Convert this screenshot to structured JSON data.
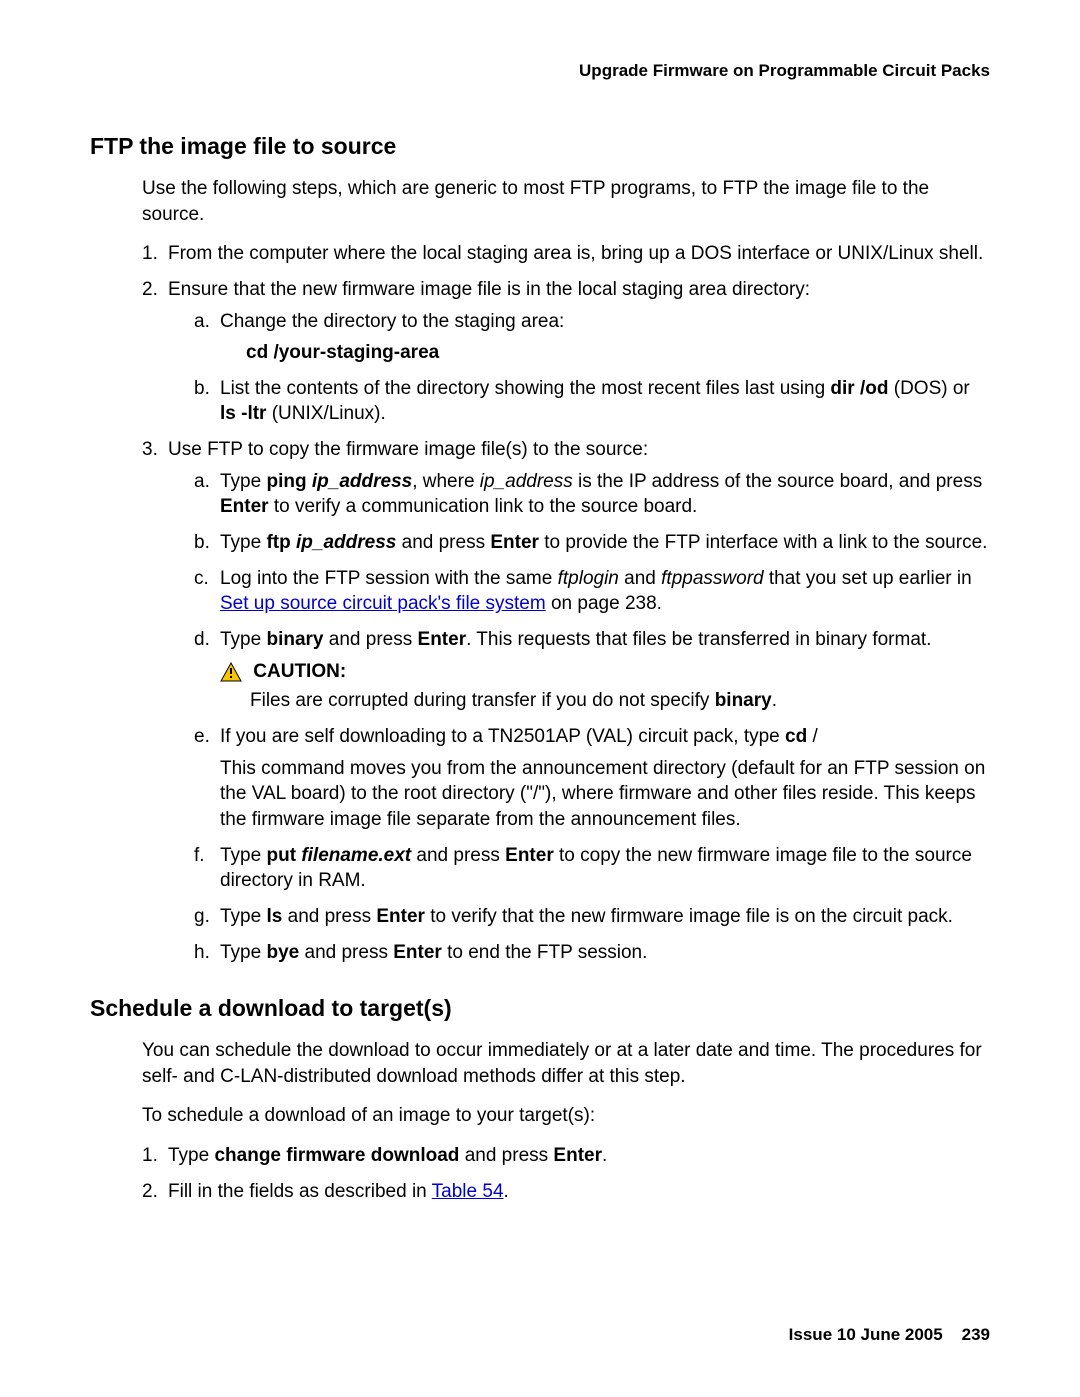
{
  "header": {
    "running_head": "Upgrade Firmware on Programmable Circuit Packs"
  },
  "section1": {
    "title": "FTP the image file to source",
    "intro": "Use the following steps, which are generic to most FTP programs, to FTP the image file to the source.",
    "step1": {
      "marker": "1.",
      "text": "From the computer where the local staging area is, bring up a DOS interface or UNIX/Linux shell."
    },
    "step2": {
      "marker": "2.",
      "text": "Ensure that the new firmware image file is in the local staging area directory:",
      "a": {
        "marker": "a.",
        "text": "Change the directory to the staging area:"
      },
      "cmd": "cd /your-staging-area",
      "b": {
        "marker": "b.",
        "pre": "List the contents of the directory showing the most recent files last using ",
        "cmd1": "dir /od",
        "mid": " (DOS) or ",
        "cmd2": "ls -ltr",
        "post": " (UNIX/Linux)."
      }
    },
    "step3": {
      "marker": "3.",
      "text": "Use FTP to copy the firmware image file(s) to the source:",
      "a": {
        "marker": "a.",
        "t1": "Type ",
        "cmd_ping": "ping ",
        "arg_ip": "ip_address",
        "t2": ", where ",
        "arg_ip2": "ip_address",
        "t3": " is the IP address of the source board, and press ",
        "enter": "Enter",
        "t4": " to verify a communication link to the source board."
      },
      "b": {
        "marker": "b.",
        "t1": "Type ",
        "cmd_ftp": "ftp ",
        "arg_ip": "ip_address",
        "t2": " and press ",
        "enter": "Enter",
        "t3": " to provide the FTP interface with a link to the source."
      },
      "c": {
        "marker": "c.",
        "t1": "Log into the FTP session with the same ",
        "arg1": "ftplogin",
        "t2": " and ",
        "arg2": "ftppassword",
        "t3": " that you set up earlier in ",
        "link": "Set up source circuit pack's file system",
        "t4": " on page 238."
      },
      "d": {
        "marker": "d.",
        "t1": "Type ",
        "cmd": "binary",
        "t2": " and press ",
        "enter": "Enter",
        "t3": ". This requests that files be transferred in binary format."
      },
      "caution": {
        "label": "CAUTION:",
        "t1": "Files are corrupted during transfer if you do not specify ",
        "b": "binary",
        "t2": "."
      },
      "e": {
        "marker": "e.",
        "t1": "If you are self downloading to a TN2501AP (VAL) circuit pack, type ",
        "cmd": "cd",
        "t2": " /",
        "para2": "This command moves you from the announcement directory (default for an FTP session on the VAL board) to the root directory (\"/\"), where firmware and other files reside. This keeps the firmware image file separate from the announcement files."
      },
      "f": {
        "marker": "f.",
        "t1": "Type ",
        "cmd": "put ",
        "arg": "filename.ext",
        "t2": " and press ",
        "enter": "Enter",
        "t3": " to copy the new firmware image file to the source directory in RAM."
      },
      "g": {
        "marker": "g.",
        "t1": "Type ",
        "cmd": "ls",
        "t2": " and press ",
        "enter": "Enter",
        "t3": " to verify that the new firmware image file is on the circuit pack."
      },
      "h": {
        "marker": "h.",
        "t1": "Type ",
        "cmd": "bye",
        "t2": " and press ",
        "enter": "Enter",
        "t3": " to end the FTP session."
      }
    }
  },
  "section2": {
    "title": "Schedule a download to target(s)",
    "p1": "You can schedule the download to occur immediately or at a later date and time. The procedures for self- and C-LAN-distributed download methods differ at this step.",
    "p2": "To schedule a download of an image to your target(s):",
    "step1": {
      "marker": "1.",
      "t1": "Type ",
      "cmd": "change firmware download",
      "t2": " and press ",
      "enter": "Enter",
      "t3": "."
    },
    "step2": {
      "marker": "2.",
      "t1": "Fill in the fields as described in ",
      "link": "Table 54",
      "t2": "."
    }
  },
  "footer": {
    "issue": "Issue 10   June 2005",
    "page": "239"
  }
}
